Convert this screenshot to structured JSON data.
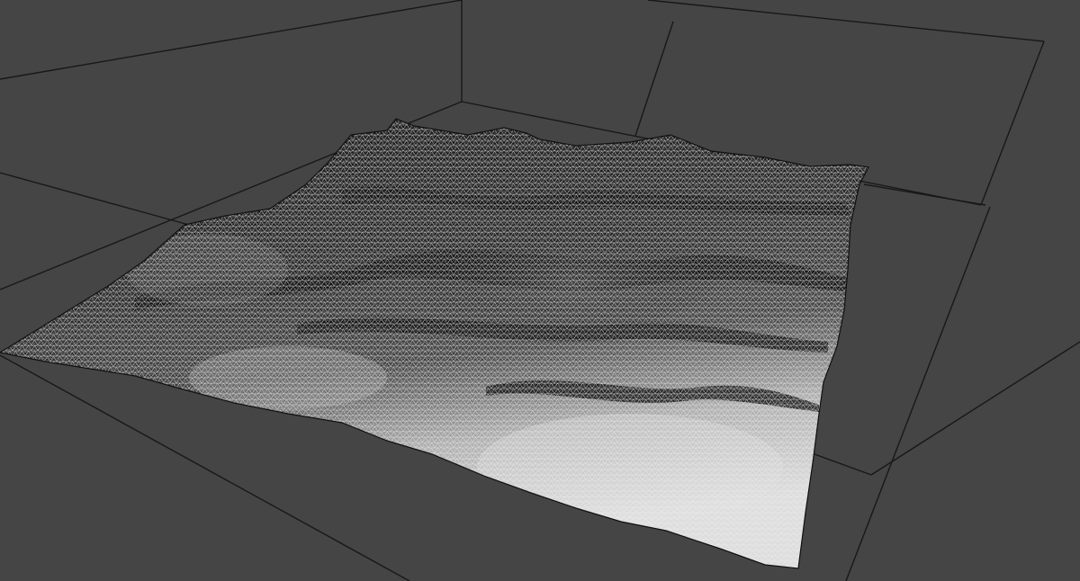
{
  "viewport": {
    "background_color": "#454545",
    "grid_line_color": "#181818",
    "mesh_wire_color": "#f2f2f2",
    "mesh_fill_dark": "#0e0e0e",
    "mesh_fill_mid": "#3a3a3a",
    "mesh_fill_light": "#d8d8d8",
    "object_display": "wireframe",
    "object_kind": "terrain-mesh"
  }
}
